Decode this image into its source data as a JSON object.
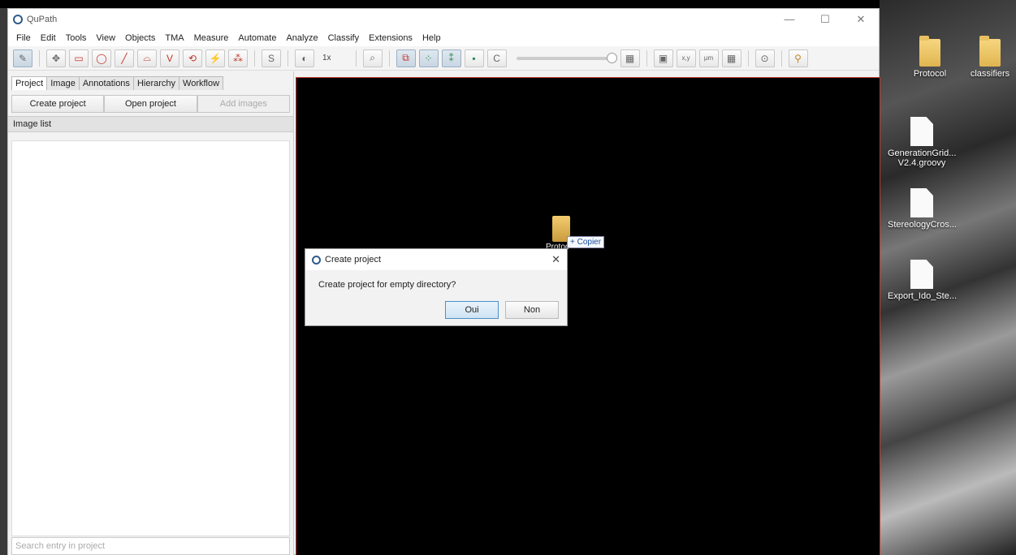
{
  "window": {
    "title": "QuPath",
    "controls": [
      "—",
      "☐",
      "✕"
    ]
  },
  "menu": [
    "File",
    "Edit",
    "Tools",
    "View",
    "Objects",
    "TMA",
    "Measure",
    "Automate",
    "Analyze",
    "Classify",
    "Extensions",
    "Help"
  ],
  "toolbar": {
    "zoom_label": "1x",
    "tool_glyphs": [
      "✎",
      "✥",
      "▭",
      "◯",
      "╱",
      "⌓",
      "V",
      "⟲",
      "⚡",
      "⁂",
      "S",
      "◐",
      "⌕",
      "⧉",
      "⁘",
      "⁑",
      "▪",
      "C",
      "▦",
      "▣",
      "x,y",
      "μm",
      "▦",
      "⊙",
      "⚲"
    ]
  },
  "left_panel": {
    "tabs": [
      "Project",
      "Image",
      "Annotations",
      "Hierarchy",
      "Workflow"
    ],
    "buttons": {
      "create": "Create project",
      "open": "Open project",
      "add": "Add images"
    },
    "list_header": "Image list",
    "search_placeholder": "Search entry in project"
  },
  "drag": {
    "label": "Protoc",
    "copier": "+ Copier"
  },
  "dialog": {
    "title": "Create project",
    "message": "Create project for empty directory?",
    "yes": "Oui",
    "no": "Non",
    "close": "✕"
  },
  "desktop": {
    "icons": [
      {
        "label": "Protocol",
        "kind": "folder"
      },
      {
        "label": "classifiers",
        "kind": "folder"
      },
      {
        "label": "GenerationGrid... V2.4.groovy",
        "kind": "file"
      },
      {
        "label": "StereologyCros...",
        "kind": "file"
      },
      {
        "label": "Export_Ido_Ste...",
        "kind": "file"
      }
    ]
  }
}
